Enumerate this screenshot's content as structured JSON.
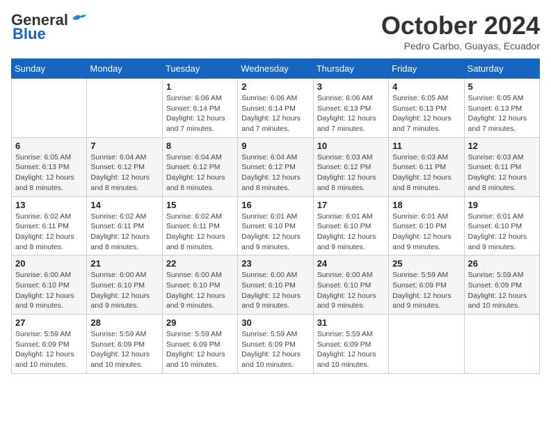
{
  "header": {
    "logo_general": "General",
    "logo_blue": "Blue",
    "month_title": "October 2024",
    "subtitle": "Pedro Carbo, Guayas, Ecuador"
  },
  "days_of_week": [
    "Sunday",
    "Monday",
    "Tuesday",
    "Wednesday",
    "Thursday",
    "Friday",
    "Saturday"
  ],
  "weeks": [
    [
      {
        "day": "",
        "info": ""
      },
      {
        "day": "",
        "info": ""
      },
      {
        "day": "1",
        "info": "Sunrise: 6:06 AM\nSunset: 6:14 PM\nDaylight: 12 hours and 7 minutes."
      },
      {
        "day": "2",
        "info": "Sunrise: 6:06 AM\nSunset: 6:14 PM\nDaylight: 12 hours and 7 minutes."
      },
      {
        "day": "3",
        "info": "Sunrise: 6:06 AM\nSunset: 6:13 PM\nDaylight: 12 hours and 7 minutes."
      },
      {
        "day": "4",
        "info": "Sunrise: 6:05 AM\nSunset: 6:13 PM\nDaylight: 12 hours and 7 minutes."
      },
      {
        "day": "5",
        "info": "Sunrise: 6:05 AM\nSunset: 6:13 PM\nDaylight: 12 hours and 7 minutes."
      }
    ],
    [
      {
        "day": "6",
        "info": "Sunrise: 6:05 AM\nSunset: 6:13 PM\nDaylight: 12 hours and 8 minutes."
      },
      {
        "day": "7",
        "info": "Sunrise: 6:04 AM\nSunset: 6:12 PM\nDaylight: 12 hours and 8 minutes."
      },
      {
        "day": "8",
        "info": "Sunrise: 6:04 AM\nSunset: 6:12 PM\nDaylight: 12 hours and 8 minutes."
      },
      {
        "day": "9",
        "info": "Sunrise: 6:04 AM\nSunset: 6:12 PM\nDaylight: 12 hours and 8 minutes."
      },
      {
        "day": "10",
        "info": "Sunrise: 6:03 AM\nSunset: 6:12 PM\nDaylight: 12 hours and 8 minutes."
      },
      {
        "day": "11",
        "info": "Sunrise: 6:03 AM\nSunset: 6:11 PM\nDaylight: 12 hours and 8 minutes."
      },
      {
        "day": "12",
        "info": "Sunrise: 6:03 AM\nSunset: 6:11 PM\nDaylight: 12 hours and 8 minutes."
      }
    ],
    [
      {
        "day": "13",
        "info": "Sunrise: 6:02 AM\nSunset: 6:11 PM\nDaylight: 12 hours and 8 minutes."
      },
      {
        "day": "14",
        "info": "Sunrise: 6:02 AM\nSunset: 6:11 PM\nDaylight: 12 hours and 8 minutes."
      },
      {
        "day": "15",
        "info": "Sunrise: 6:02 AM\nSunset: 6:11 PM\nDaylight: 12 hours and 8 minutes."
      },
      {
        "day": "16",
        "info": "Sunrise: 6:01 AM\nSunset: 6:10 PM\nDaylight: 12 hours and 9 minutes."
      },
      {
        "day": "17",
        "info": "Sunrise: 6:01 AM\nSunset: 6:10 PM\nDaylight: 12 hours and 9 minutes."
      },
      {
        "day": "18",
        "info": "Sunrise: 6:01 AM\nSunset: 6:10 PM\nDaylight: 12 hours and 9 minutes."
      },
      {
        "day": "19",
        "info": "Sunrise: 6:01 AM\nSunset: 6:10 PM\nDaylight: 12 hours and 9 minutes."
      }
    ],
    [
      {
        "day": "20",
        "info": "Sunrise: 6:00 AM\nSunset: 6:10 PM\nDaylight: 12 hours and 9 minutes."
      },
      {
        "day": "21",
        "info": "Sunrise: 6:00 AM\nSunset: 6:10 PM\nDaylight: 12 hours and 9 minutes."
      },
      {
        "day": "22",
        "info": "Sunrise: 6:00 AM\nSunset: 6:10 PM\nDaylight: 12 hours and 9 minutes."
      },
      {
        "day": "23",
        "info": "Sunrise: 6:00 AM\nSunset: 6:10 PM\nDaylight: 12 hours and 9 minutes."
      },
      {
        "day": "24",
        "info": "Sunrise: 6:00 AM\nSunset: 6:10 PM\nDaylight: 12 hours and 9 minutes."
      },
      {
        "day": "25",
        "info": "Sunrise: 5:59 AM\nSunset: 6:09 PM\nDaylight: 12 hours and 9 minutes."
      },
      {
        "day": "26",
        "info": "Sunrise: 5:59 AM\nSunset: 6:09 PM\nDaylight: 12 hours and 10 minutes."
      }
    ],
    [
      {
        "day": "27",
        "info": "Sunrise: 5:59 AM\nSunset: 6:09 PM\nDaylight: 12 hours and 10 minutes."
      },
      {
        "day": "28",
        "info": "Sunrise: 5:59 AM\nSunset: 6:09 PM\nDaylight: 12 hours and 10 minutes."
      },
      {
        "day": "29",
        "info": "Sunrise: 5:59 AM\nSunset: 6:09 PM\nDaylight: 12 hours and 10 minutes."
      },
      {
        "day": "30",
        "info": "Sunrise: 5:59 AM\nSunset: 6:09 PM\nDaylight: 12 hours and 10 minutes."
      },
      {
        "day": "31",
        "info": "Sunrise: 5:59 AM\nSunset: 6:09 PM\nDaylight: 12 hours and 10 minutes."
      },
      {
        "day": "",
        "info": ""
      },
      {
        "day": "",
        "info": ""
      }
    ]
  ]
}
